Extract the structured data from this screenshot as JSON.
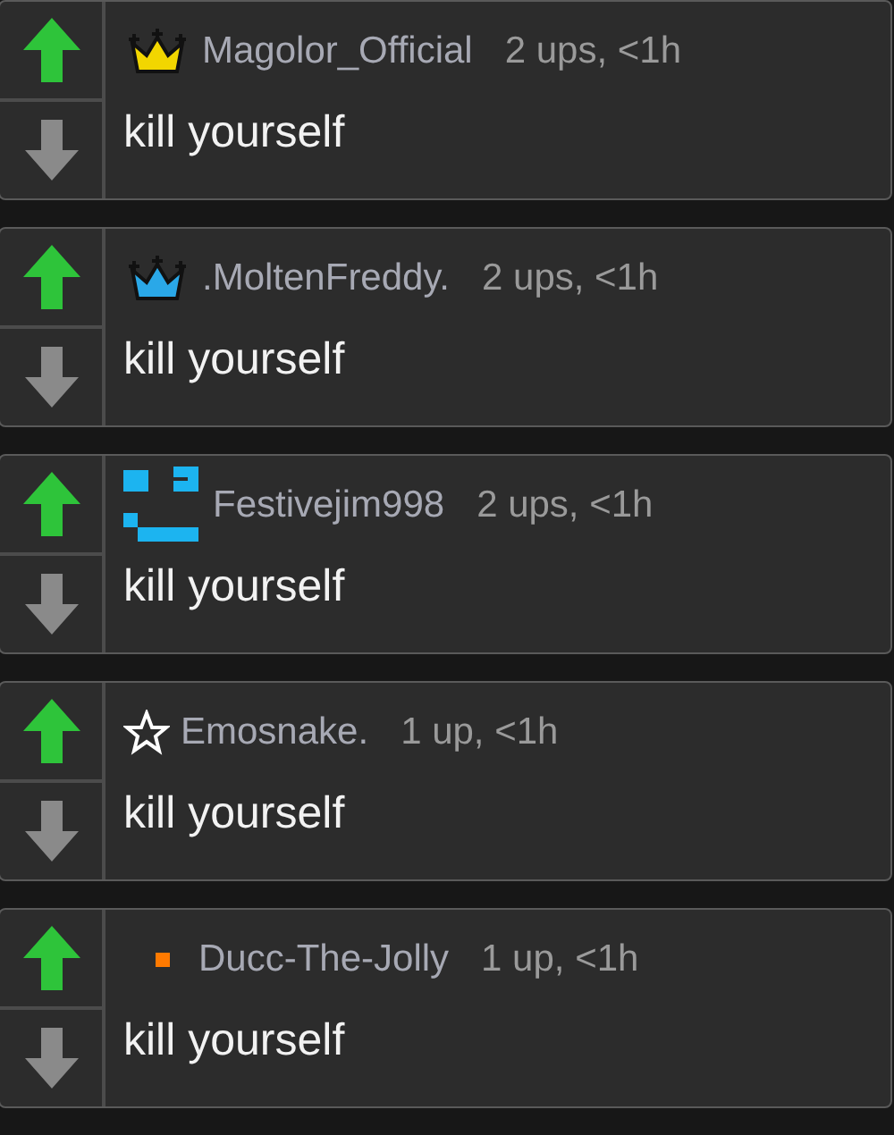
{
  "comments": [
    {
      "username": "Magolor_Official",
      "meta": "2 ups, <1h",
      "text": "kill yourself",
      "badge": {
        "kind": "crown",
        "color": "#f2d600"
      }
    },
    {
      "username": ".MoltenFreddy.",
      "meta": "2 ups, <1h",
      "text": "kill yourself",
      "badge": {
        "kind": "crown",
        "color": "#2aa8e8"
      }
    },
    {
      "username": "Festivejim998",
      "meta": "2 ups, <1h",
      "text": "kill yourself",
      "badge": {
        "kind": "pixel",
        "color": "#1cb4f0"
      }
    },
    {
      "username": "Emosnake.",
      "meta": "1 up, <1h",
      "text": "kill yourself",
      "badge": {
        "kind": "star",
        "color": "#ffffff"
      }
    },
    {
      "username": "Ducc-The-Jolly",
      "meta": "1 up, <1h",
      "text": "kill yourself",
      "badge": {
        "kind": "square",
        "color": "#ff7a00"
      }
    }
  ]
}
